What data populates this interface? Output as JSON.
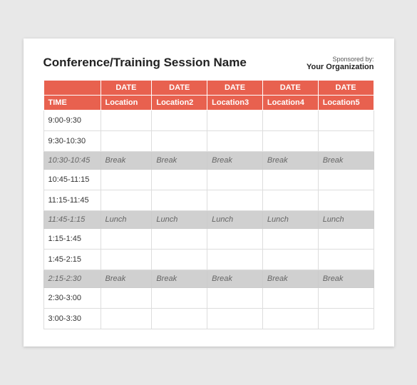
{
  "header": {
    "title": "Conference/Training Session Name",
    "sponsored_label": "Sponsored by:",
    "org_name": "Your Organization"
  },
  "table": {
    "date_headers": [
      "",
      "DATE",
      "DATE",
      "DATE",
      "DATE",
      "DATE"
    ],
    "location_headers": [
      "TIME",
      "Location",
      "Location2",
      "Location3",
      "Location4",
      "Location5"
    ],
    "rows": [
      {
        "type": "normal",
        "time": "9:00-9:30",
        "cells": [
          "",
          "",
          "",
          "",
          ""
        ]
      },
      {
        "type": "normal",
        "time": "9:30-10:30",
        "cells": [
          "",
          "",
          "",
          "",
          ""
        ]
      },
      {
        "type": "special",
        "time": "10:30-10:45",
        "cells": [
          "Break",
          "Break",
          "Break",
          "Break",
          "Break"
        ]
      },
      {
        "type": "normal",
        "time": "10:45-11:15",
        "cells": [
          "",
          "",
          "",
          "",
          ""
        ]
      },
      {
        "type": "normal",
        "time": "11:15-11:45",
        "cells": [
          "",
          "",
          "",
          "",
          ""
        ]
      },
      {
        "type": "special",
        "time": "11:45-1:15",
        "cells": [
          "Lunch",
          "Lunch",
          "Lunch",
          "Lunch",
          "Lunch"
        ]
      },
      {
        "type": "normal",
        "time": "1:15-1:45",
        "cells": [
          "",
          "",
          "",
          "",
          ""
        ]
      },
      {
        "type": "normal",
        "time": "1:45-2:15",
        "cells": [
          "",
          "",
          "",
          "",
          ""
        ]
      },
      {
        "type": "special",
        "time": "2:15-2:30",
        "cells": [
          "Break",
          "Break",
          "Break",
          "Break",
          "Break"
        ]
      },
      {
        "type": "normal",
        "time": "2:30-3:00",
        "cells": [
          "",
          "",
          "",
          "",
          ""
        ]
      },
      {
        "type": "normal",
        "time": "3:00-3:30",
        "cells": [
          "",
          "",
          "",
          "",
          ""
        ]
      }
    ]
  }
}
